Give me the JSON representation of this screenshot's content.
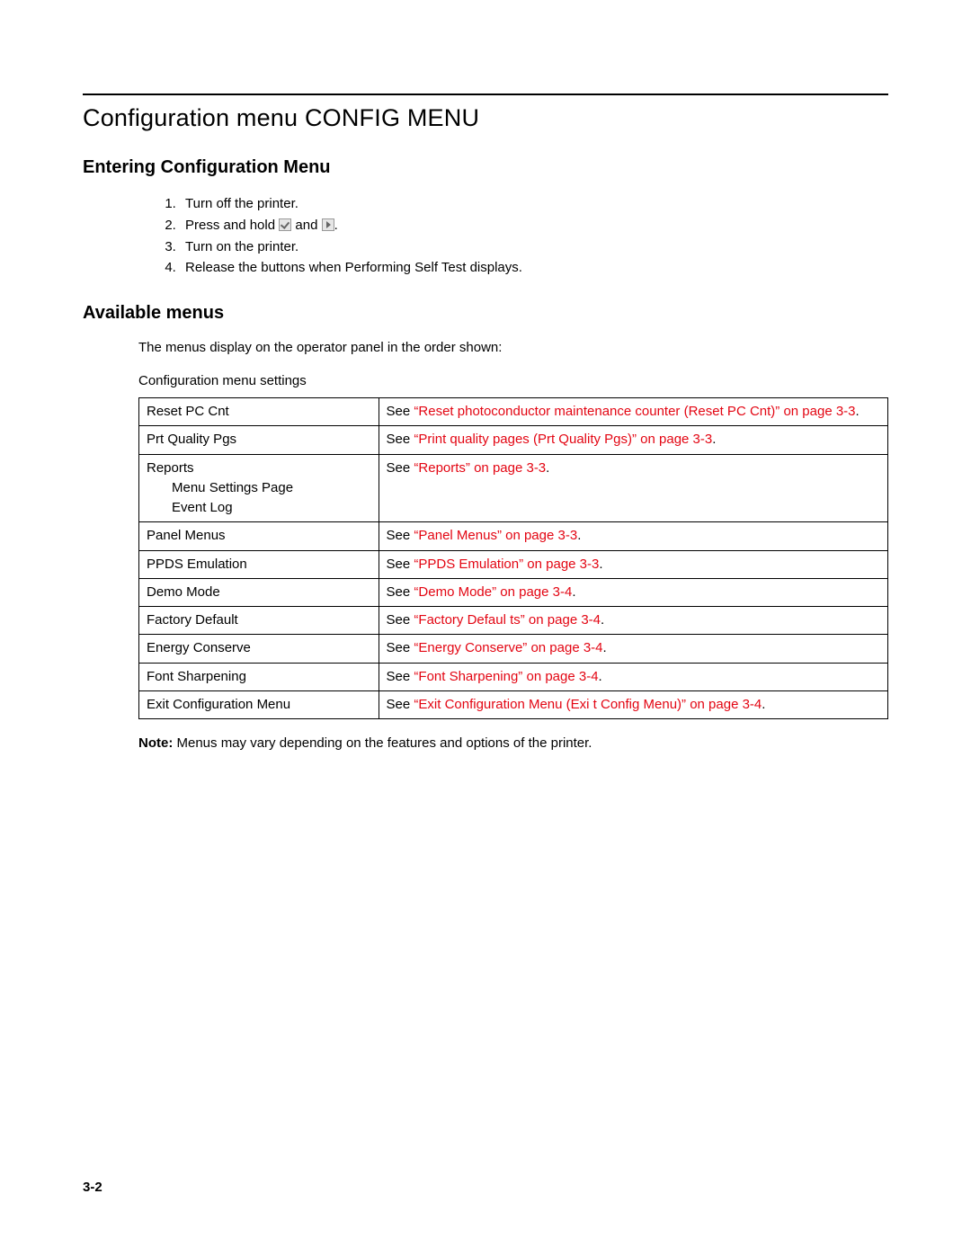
{
  "heading": "Configuration menu CONFIG MENU",
  "section1": {
    "title": "Entering Configuration Menu",
    "steps": [
      "Turn off the printer.",
      "__PRESS_HOLD__",
      "Turn on the printer.",
      "Release the buttons when Performing Self Test displays."
    ],
    "press_hold_prefix": "Press and hold ",
    "press_hold_mid": " and ",
    "press_hold_suffix": "."
  },
  "section2": {
    "title": "Available menus",
    "intro": "The menus display on the operator panel in the order shown:",
    "table_caption": "Configuration menu settings",
    "rows": [
      {
        "name": "Reset PC Cnt",
        "see": "See ",
        "link": "“Reset photoconductor maintenance counter (Reset PC Cnt)” on page 3-3",
        "tail": "."
      },
      {
        "name": "Prt Quality Pgs",
        "see": "See ",
        "link": "“Print quality pages (Prt Quality Pgs)” on page 3-3",
        "tail": "."
      },
      {
        "name": "Reports",
        "sub": [
          "Menu Settings Page",
          "Event Log"
        ],
        "see": "See ",
        "link": "“Reports” on page 3-3",
        "tail": "."
      },
      {
        "name": "Panel Menus",
        "see": "See ",
        "link": "“Panel Menus” on page 3-3",
        "tail": "."
      },
      {
        "name": "PPDS Emulation",
        "see": "See ",
        "link": "“PPDS Emulation” on page 3-3",
        "tail": "."
      },
      {
        "name": "Demo Mode",
        "see": "See ",
        "link": "“Demo Mode” on page 3-4",
        "tail": "."
      },
      {
        "name": "Factory Default",
        "see": "See ",
        "link": "“Factory Defaul   ts” on page 3-4",
        "tail": "."
      },
      {
        "name": "Energy Conserve",
        "see": "See ",
        "link": "“Energy Conserve” on page 3-4",
        "tail": "."
      },
      {
        "name": "Font Sharpening",
        "see": "See ",
        "link": "“Font Sharpening” on page 3-4",
        "tail": "."
      },
      {
        "name": "Exit Configuration Menu",
        "see": "See ",
        "link": "“Exit Configuration Menu (Exi    t Config Menu)” on page 3-4",
        "tail": "."
      }
    ],
    "note_label": "Note:  ",
    "note_text": "Menus may vary depending on the features and options of the printer."
  },
  "footer": "3-2"
}
